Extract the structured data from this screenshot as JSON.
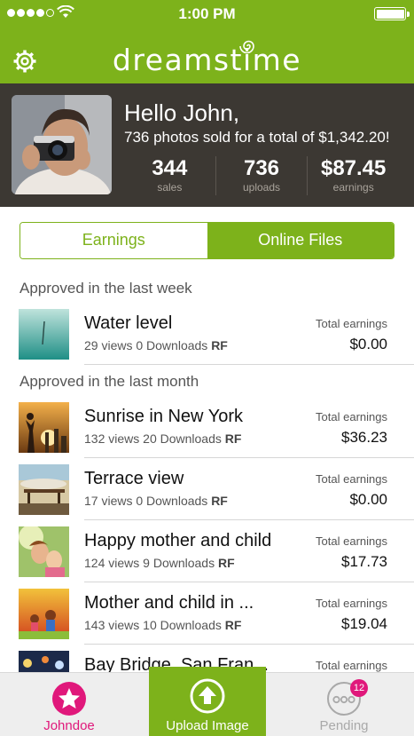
{
  "status_bar": {
    "time": "1:00 PM"
  },
  "header": {
    "logo_text": "dreamstime"
  },
  "profile": {
    "greeting": "Hello John,",
    "summary": "736 photos sold for a total of $1,342.20!",
    "stats": [
      {
        "value": "344",
        "label": "sales"
      },
      {
        "value": "736",
        "label": "uploads"
      },
      {
        "value": "$87.45",
        "label": "earnings"
      }
    ]
  },
  "tabs": {
    "earnings": "Earnings",
    "online_files": "Online Files"
  },
  "sections": {
    "week": "Approved in the last week",
    "month": "Approved in the last month"
  },
  "items": [
    {
      "title": "Water level",
      "views": "29 views",
      "downloads": "0 Downloads",
      "license": "RF",
      "earnings_label": "Total earnings",
      "earnings": "$0.00"
    },
    {
      "title": "Sunrise in New York",
      "views": "132 views",
      "downloads": "20 Downloads",
      "license": "RF",
      "earnings_label": "Total earnings",
      "earnings": "$36.23"
    },
    {
      "title": "Terrace view",
      "views": "17 views",
      "downloads": "0 Downloads",
      "license": "RF",
      "earnings_label": "Total earnings",
      "earnings": "$0.00"
    },
    {
      "title": "Happy mother and child",
      "views": "124 views",
      "downloads": "9 Downloads",
      "license": "RF",
      "earnings_label": "Total earnings",
      "earnings": "$17.73"
    },
    {
      "title": "Mother and child in ...",
      "views": "143 views",
      "downloads": "10 Downloads",
      "license": "RF",
      "earnings_label": "Total earnings",
      "earnings": "$19.04"
    },
    {
      "title": "Bay Bridge, San Fran...",
      "earnings_label": "Total earnings"
    }
  ],
  "tab_bar": {
    "user": "Johndoe",
    "upload": "Upload Image",
    "pending": "Pending",
    "pending_count": "12"
  },
  "colors": {
    "brand_green": "#7db21b",
    "profile_bg": "#3c3833",
    "accent_pink": "#e0187b"
  }
}
